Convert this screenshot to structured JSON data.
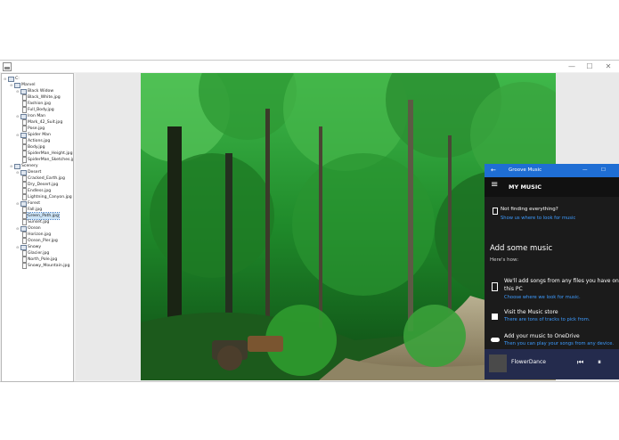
{
  "window": {
    "minimize_glyph": "—",
    "maximize_glyph": "☐",
    "close_glyph": "✕"
  },
  "tree": [
    {
      "label": "C:",
      "kind": "folder",
      "level": 0,
      "toggle": "⊖"
    },
    {
      "label": "Marvel",
      "kind": "folder",
      "level": 1,
      "toggle": "⊖"
    },
    {
      "label": "Black Widow",
      "kind": "folder",
      "level": 2,
      "toggle": "⊖"
    },
    {
      "label": "Black_White.jpg",
      "kind": "file",
      "level": 3
    },
    {
      "label": "Fashion.jpg",
      "kind": "file",
      "level": 3
    },
    {
      "label": "Full_Body.jpg",
      "kind": "file",
      "level": 3
    },
    {
      "label": "Iron Man",
      "kind": "folder",
      "level": 2,
      "toggle": "⊖"
    },
    {
      "label": "Mark_42_Suit.jpg",
      "kind": "file",
      "level": 3
    },
    {
      "label": "Pose.jpg",
      "kind": "file",
      "level": 3
    },
    {
      "label": "Spider Man",
      "kind": "folder",
      "level": 2,
      "toggle": "⊖"
    },
    {
      "label": "Actions.jpg",
      "kind": "file",
      "level": 3
    },
    {
      "label": "Body.jpg",
      "kind": "file",
      "level": 3
    },
    {
      "label": "SpiderMan_Height.jpg",
      "kind": "file",
      "level": 3
    },
    {
      "label": "SpiderMan_Sketches.jpg",
      "kind": "file",
      "level": 3
    },
    {
      "label": "Scenery",
      "kind": "folder",
      "level": 1,
      "toggle": "⊖"
    },
    {
      "label": "Desert",
      "kind": "folder",
      "level": 2,
      "toggle": "⊖"
    },
    {
      "label": "Cracked_Earth.jpg",
      "kind": "file",
      "level": 3
    },
    {
      "label": "Dry_Desert.jpg",
      "kind": "file",
      "level": 3
    },
    {
      "label": "Endless.jpg",
      "kind": "file",
      "level": 3
    },
    {
      "label": "Lightning_Canyon.jpg",
      "kind": "file",
      "level": 3
    },
    {
      "label": "Forest",
      "kind": "folder",
      "level": 2,
      "toggle": "⊖"
    },
    {
      "label": "Fall.jpg",
      "kind": "file",
      "level": 3
    },
    {
      "label": "Green_Path.jpg",
      "kind": "file",
      "level": 3,
      "selected": true
    },
    {
      "label": "Sunset.jpg",
      "kind": "file",
      "level": 3
    },
    {
      "label": "Ocean",
      "kind": "folder",
      "level": 2,
      "toggle": "⊖"
    },
    {
      "label": "Horizon.jpg",
      "kind": "file",
      "level": 3
    },
    {
      "label": "Ocean_Pier.jpg",
      "kind": "file",
      "level": 3
    },
    {
      "label": "Snowy",
      "kind": "folder",
      "level": 2,
      "toggle": "⊖"
    },
    {
      "label": "Glacier.jpg",
      "kind": "file",
      "level": 3
    },
    {
      "label": "North_Pole.jpg",
      "kind": "file",
      "level": 3
    },
    {
      "label": "Snowy_Mountain.jpg",
      "kind": "file",
      "level": 3
    }
  ],
  "groove": {
    "back_glyph": "←",
    "title": "Groove Music",
    "minimize_glyph": "—",
    "maximize_glyph": "☐",
    "menu_glyph": "≡",
    "section": "MY MUSIC",
    "not_finding": "Not finding everything?",
    "show_us": "Show us where to look for music",
    "add_music": "Add some music",
    "heres_how": "Here's how:",
    "option1_line1": "We'll add songs from any files you have on",
    "option1_line2": "this PC",
    "option1_link": "Choose where we look for music.",
    "option2": "Visit the Music store",
    "option2_link": "There are tons of tracks to pick from.",
    "option3": "Add your music to OneDrive",
    "option3_link": "Then you can play your songs from any device.",
    "track": "FlowerDance",
    "prev_glyph": "⏮",
    "pause_glyph": "⏸"
  },
  "colors": {
    "accent": "#1f6ed4",
    "link": "#3d9bff",
    "player_bg": "#242b4d"
  }
}
